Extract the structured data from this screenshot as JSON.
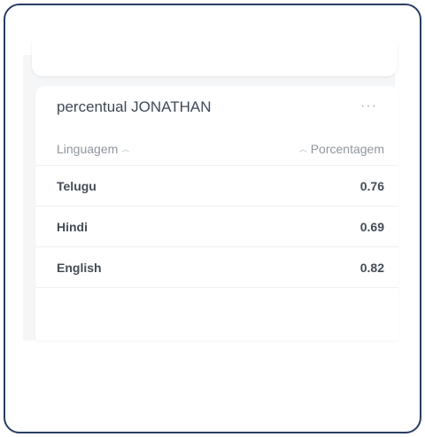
{
  "card": {
    "title": "percentual JONATHAN",
    "more_icon": "more-horizontal-icon"
  },
  "table": {
    "columns": [
      {
        "label": "Linguagem",
        "sort_icon": "chevron-up-icon"
      },
      {
        "label": "Porcentagem",
        "sort_icon": "chevron-up-icon"
      }
    ],
    "rows": [
      {
        "language": "Telugu",
        "percentage": "0.76"
      },
      {
        "language": "Hindi",
        "percentage": "0.69"
      },
      {
        "language": "English",
        "percentage": "0.82"
      }
    ]
  }
}
